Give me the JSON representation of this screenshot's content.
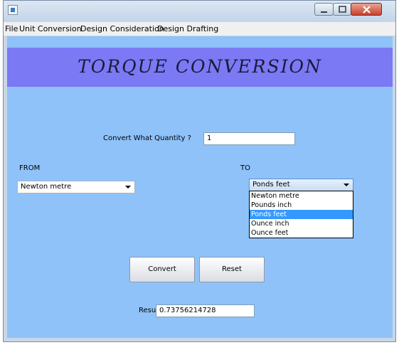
{
  "window": {
    "title": ""
  },
  "menubar": {
    "items": [
      "File",
      "Unit Conversion",
      "Design Consideration",
      "Design Drafting"
    ]
  },
  "banner": {
    "title": "TORQUE  CONVERSION"
  },
  "quantity": {
    "label": "Convert What Quantity ?",
    "value": "1"
  },
  "from": {
    "label": "FROM",
    "selected": "Newton metre"
  },
  "to": {
    "label": "TO",
    "selected": "Ponds feet",
    "options": [
      "Newton metre",
      "Pounds inch",
      "Ponds feet",
      "Ounce inch",
      "Ounce feet"
    ]
  },
  "buttons": {
    "convert": "Convert",
    "reset": "Reset"
  },
  "result": {
    "label": "Result",
    "value": "0.73756214728"
  },
  "colors": {
    "banner": "#7b79f4",
    "panel": "#8fc2f9",
    "selection": "#3399ff"
  }
}
